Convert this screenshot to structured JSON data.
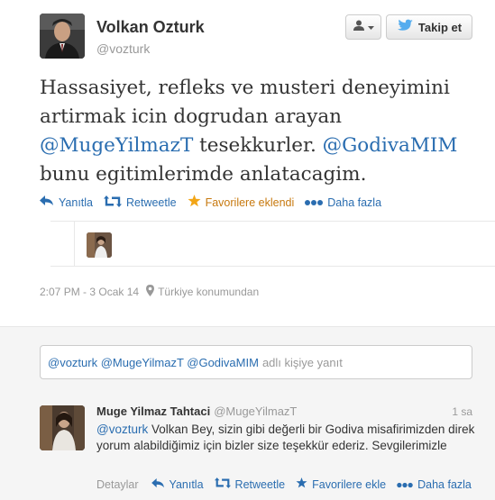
{
  "tweet": {
    "author_name": "Volkan Ozturk",
    "author_handle": "@vozturk",
    "text_1": "Hassasiyet, refleks ve musteri deneyimini artirmak icin dogrudan arayan ",
    "mention_1": "@MugeYilmazT",
    "text_2": " tesekkurler. ",
    "mention_2": "@GodivaMIM",
    "text_3": " bunu egitimlerimde anlatacagim.",
    "timestamp": "2:07 PM - 3 Ocak 14",
    "location": "Türkiye konumundan"
  },
  "header": {
    "follow_label": "Takip et"
  },
  "actions": {
    "reply": "Yanıtla",
    "retweet": "Retweetle",
    "favorited": "Favorilere eklendi",
    "more": "Daha fazla"
  },
  "reply_box": {
    "mentions": "@vozturk @MugeYilmazT @GodivaMIM",
    "placeholder": "adlı kişiye yanıt"
  },
  "reply_tweet": {
    "author_name": "Muge Yilmaz Tahtaci",
    "author_handle": "@MugeYilmazT",
    "time": "1 sa",
    "mention": "@vozturk",
    "text": " Volkan Bey, sizin gibi değerli bir Godiva misafirimizden direk yorum alabildiğimiz için bizler size teşekkür ederiz. Sevgilerimizle",
    "details": "Detaylar",
    "reply": "Yanıtla",
    "retweet": "Retweetle",
    "favorite": "Favorilere ekle",
    "more": "Daha fazla"
  },
  "colors": {
    "link": "#2a6db0",
    "favorited": "#c7790f",
    "twitter_bird": "#55acee"
  }
}
